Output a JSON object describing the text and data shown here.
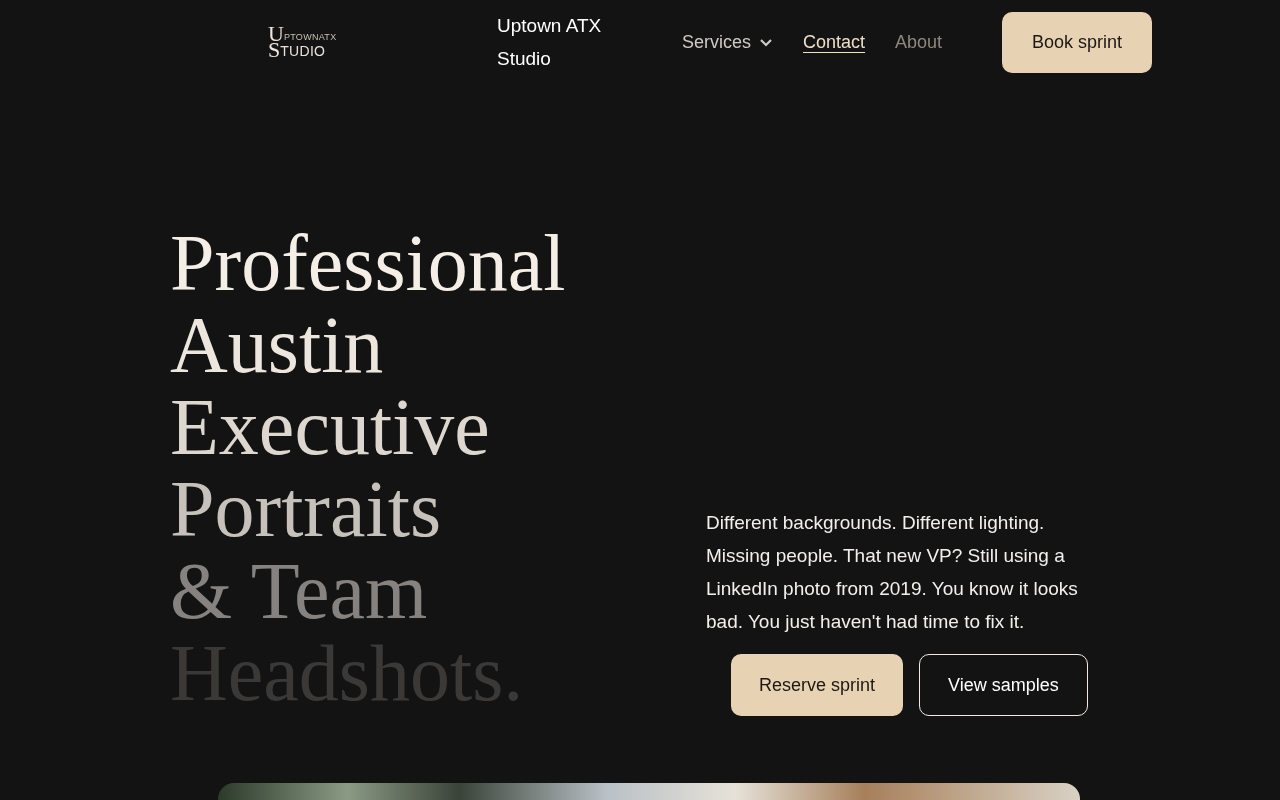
{
  "logo": {
    "initial_top": "U",
    "line_top": "PTOWNATX",
    "initial_bottom": "S",
    "line_bottom": "TUDIO"
  },
  "brand": "Uptown ATX Studio",
  "nav": [
    {
      "label": "Services",
      "kind": "dropdown",
      "selected": false,
      "muted": false
    },
    {
      "label": "Contact",
      "kind": "link",
      "selected": true,
      "muted": false
    },
    {
      "label": "About",
      "kind": "link",
      "selected": false,
      "muted": true
    }
  ],
  "cta": "Book sprint",
  "headline": [
    {
      "text": "Professional",
      "color": "#f4eee7"
    },
    {
      "text": "Austin",
      "color": "#ece6df"
    },
    {
      "text": "Executive",
      "color": "#ddd7d0"
    },
    {
      "text": "Portraits",
      "color": "#c6c1bb"
    },
    {
      "text": "& Team",
      "color": "#858280"
    },
    {
      "text": "Headshots.",
      "color": "#3a3938"
    }
  ],
  "intro": "Different backgrounds. Different lighting. Missing people. That new VP? Still using a LinkedIn photo from 2019. You know it looks bad. You just haven't had time to fix it.",
  "buttons": [
    {
      "label": "Reserve sprint",
      "kind": "primary"
    },
    {
      "label": "View samples",
      "kind": "outline"
    }
  ]
}
